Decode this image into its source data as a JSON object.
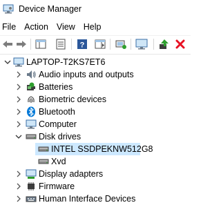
{
  "window": {
    "title": "Device Manager"
  },
  "menu": {
    "items": [
      "File",
      "Action",
      "View",
      "Help"
    ]
  },
  "toolbar": {
    "buttons": [
      "back-icon",
      "forward-icon",
      "show-hide-console-tree-icon",
      "properties-icon",
      "help-icon",
      "action-pane-icon",
      "computer-icon",
      "monitor-icon",
      "update-driver-icon",
      "uninstall-icon"
    ]
  },
  "tree": {
    "root": "LAPTOP-T2KS7ET6",
    "categories": {
      "audio": "Audio inputs and outputs",
      "batteries": "Batteries",
      "biometric": "Biometric devices",
      "bluetooth": "Bluetooth",
      "computer": "Computer",
      "disk": "Disk drives",
      "display": "Display adapters",
      "firmware": "Firmware",
      "hid": "Human Interface Devices"
    },
    "disk_children": [
      "INTEL SSDPEKNW512G8",
      "Xvd"
    ],
    "selected": "INTEL SSDPEKNW512G8"
  },
  "colors": {
    "selection": "#cce8ff",
    "accent": "#0078d7",
    "uninstall": "#e81123",
    "green": "#2e9e2e"
  }
}
